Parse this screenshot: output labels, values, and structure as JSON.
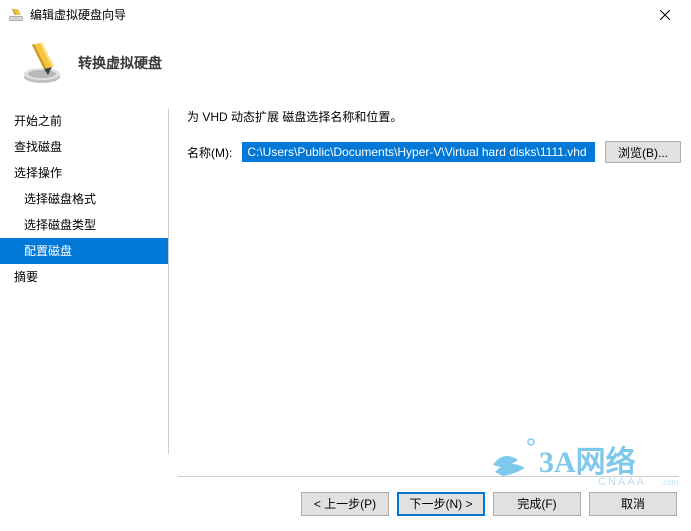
{
  "window": {
    "title": "编辑虚拟硬盘向导"
  },
  "header": {
    "title": "转换虚拟硬盘"
  },
  "sidebar": {
    "items": [
      {
        "label": "开始之前",
        "indent": false,
        "selected": false
      },
      {
        "label": "查找磁盘",
        "indent": false,
        "selected": false
      },
      {
        "label": "选择操作",
        "indent": false,
        "selected": false
      },
      {
        "label": "选择磁盘格式",
        "indent": true,
        "selected": false
      },
      {
        "label": "选择磁盘类型",
        "indent": true,
        "selected": false
      },
      {
        "label": "配置磁盘",
        "indent": true,
        "selected": true
      },
      {
        "label": "摘要",
        "indent": false,
        "selected": false
      }
    ]
  },
  "content": {
    "instruction": "为 VHD 动态扩展 磁盘选择名称和位置。",
    "name_label": "名称(M):",
    "name_value": "C:\\Users\\Public\\Documents\\Hyper-V\\Virtual hard disks\\1111.vhd",
    "browse_label": "浏览(B)..."
  },
  "footer": {
    "prev": "< 上一步(P)",
    "next": "下一步(N) >",
    "finish": "完成(F)",
    "cancel": "取消"
  },
  "watermark": {
    "text": "3A网络",
    "subtext": "CNAAA"
  }
}
